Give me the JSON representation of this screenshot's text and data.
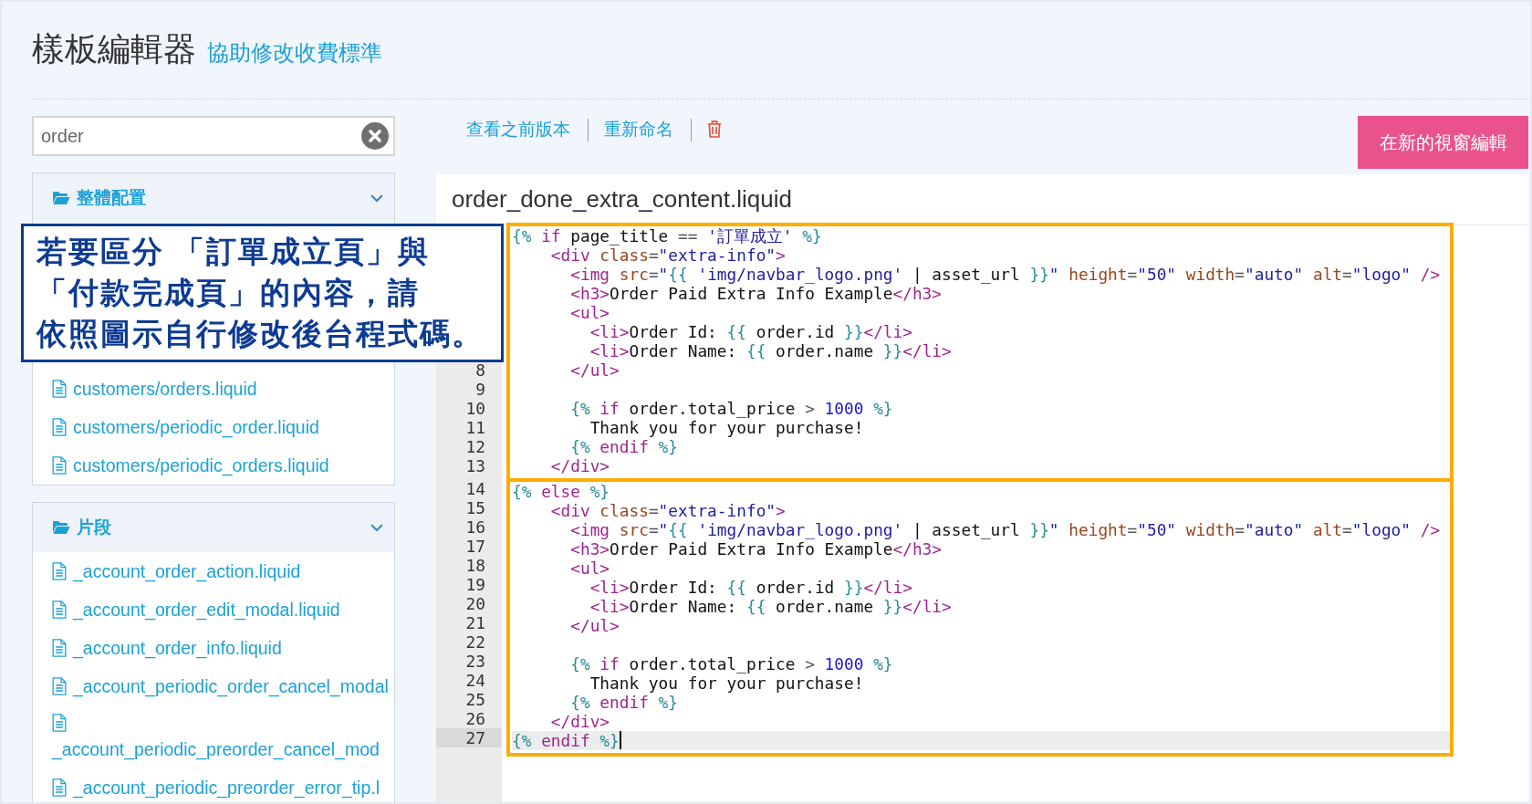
{
  "header": {
    "title": "樣板編輯器",
    "help_link": "協助修改收費標準"
  },
  "sidebar": {
    "search": {
      "value": "order"
    },
    "groups": [
      {
        "title": "整體配置",
        "expanded": true,
        "items": [
          {
            "name": "customers/orders.liquid",
            "kind": "inline"
          },
          {
            "name": "customers/periodic_order.liquid",
            "kind": "inline"
          },
          {
            "name": "customers/periodic_orders.liquid",
            "kind": "inline"
          }
        ]
      },
      {
        "title": "片段",
        "expanded": true,
        "items": [
          {
            "name": "_account_order_action.liquid",
            "kind": "inline"
          },
          {
            "name": "_account_order_edit_modal.liquid",
            "kind": "inline"
          },
          {
            "name": "_account_order_info.liquid",
            "kind": "inline"
          },
          {
            "name": "_account_periodic_order_cancel_modal",
            "kind": "inline"
          },
          {
            "name": "_account_periodic_preorder_cancel_mod",
            "kind": "stacked"
          },
          {
            "name": "_account_periodic_preorder_error_tip.l",
            "kind": "inline"
          }
        ]
      }
    ]
  },
  "toolbar": {
    "links": [
      "查看之前版本",
      "重新命名"
    ],
    "open_button": "在新的視窗編輯"
  },
  "editor": {
    "filename": "order_done_extra_content.liquid",
    "blocks": [
      {
        "lines": [
          {
            "current": false,
            "tokens": [
              {
                "kind": "delim",
                "text": "{%"
              },
              {
                "kind": "keyword",
                "text": " if"
              },
              {
                "kind": "text",
                "text": " page_title "
              },
              {
                "kind": "op",
                "text": "=="
              },
              {
                "kind": "string",
                "text": " '訂單成立'"
              },
              {
                "kind": "delim",
                "text": " %}"
              }
            ],
            "children": [
              {
                "current": false,
                "tokens": [
                  {
                    "kind": "tag",
                    "text": "<div"
                  },
                  {
                    "kind": "attr",
                    "text": " class"
                  },
                  {
                    "kind": "op",
                    "text": "="
                  },
                  {
                    "kind": "string",
                    "text": "\"extra-info\""
                  },
                  {
                    "kind": "tag",
                    "text": ">"
                  }
                ],
                "children": [
                  {
                    "current": false,
                    "tokens": [
                      {
                        "kind": "tag",
                        "text": "<img"
                      },
                      {
                        "kind": "attr",
                        "text": " src"
                      },
                      {
                        "kind": "op",
                        "text": "="
                      },
                      {
                        "kind": "string",
                        "text": "\""
                      },
                      {
                        "kind": "delim",
                        "text": "{{"
                      },
                      {
                        "kind": "string",
                        "text": " 'img/navbar_logo.png'"
                      },
                      {
                        "kind": "text",
                        "text": " | asset_url "
                      },
                      {
                        "kind": "delim",
                        "text": "}}"
                      },
                      {
                        "kind": "string",
                        "text": "\""
                      },
                      {
                        "kind": "attr",
                        "text": " height"
                      },
                      {
                        "kind": "op",
                        "text": "="
                      },
                      {
                        "kind": "string",
                        "text": "\"50\""
                      },
                      {
                        "kind": "attr",
                        "text": " width"
                      },
                      {
                        "kind": "op",
                        "text": "="
                      },
                      {
                        "kind": "string",
                        "text": "\"auto\""
                      },
                      {
                        "kind": "attr",
                        "text": " alt"
                      },
                      {
                        "kind": "op",
                        "text": "="
                      },
                      {
                        "kind": "string",
                        "text": "\"logo\""
                      },
                      {
                        "kind": "tag",
                        "text": " />"
                      }
                    ]
                  },
                  {
                    "current": false,
                    "tokens": [
                      {
                        "kind": "tag",
                        "text": "<h3>"
                      },
                      {
                        "kind": "text",
                        "text": "Order Paid Extra Info Example"
                      },
                      {
                        "kind": "tag",
                        "text": "</h3>"
                      }
                    ]
                  },
                  {
                    "current": false,
                    "tokens": [
                      {
                        "kind": "tag",
                        "text": "<ul>"
                      }
                    ],
                    "children": [
                      {
                        "current": false,
                        "tokens": [
                          {
                            "kind": "tag",
                            "text": "<li>"
                          },
                          {
                            "kind": "text",
                            "text": "Order Id: "
                          },
                          {
                            "kind": "delim",
                            "text": "{{"
                          },
                          {
                            "kind": "text",
                            "text": " order.id "
                          },
                          {
                            "kind": "delim",
                            "text": "}}"
                          },
                          {
                            "kind": "tag",
                            "text": "</li>"
                          }
                        ]
                      },
                      {
                        "current": false,
                        "tokens": [
                          {
                            "kind": "tag",
                            "text": "<li>"
                          },
                          {
                            "kind": "text",
                            "text": "Order Name: "
                          },
                          {
                            "kind": "delim",
                            "text": "{{"
                          },
                          {
                            "kind": "text",
                            "text": " order.name "
                          },
                          {
                            "kind": "delim",
                            "text": "}}"
                          },
                          {
                            "kind": "tag",
                            "text": "</li>"
                          }
                        ]
                      }
                    ]
                  },
                  {
                    "number": "8",
                    "current": false,
                    "tokens": [
                      {
                        "kind": "tag",
                        "text": "</ul>"
                      }
                    ]
                  },
                  {
                    "number": "9",
                    "current": false
                  },
                  {
                    "number": "10",
                    "current": false,
                    "tokens": [
                      {
                        "kind": "delim",
                        "text": "{%"
                      },
                      {
                        "kind": "keyword",
                        "text": " if"
                      },
                      {
                        "kind": "text",
                        "text": " order.total_price "
                      },
                      {
                        "kind": "op",
                        "text": ">"
                      },
                      {
                        "kind": "number",
                        "text": " 1000"
                      },
                      {
                        "kind": "delim",
                        "text": " %}"
                      }
                    ],
                    "children": [
                      {
                        "number": "11",
                        "current": false,
                        "tokens": [
                          {
                            "kind": "text",
                            "text": "Thank you for your purchase!"
                          }
                        ]
                      }
                    ]
                  },
                  {
                    "number": "12",
                    "current": false,
                    "tokens": [
                      {
                        "kind": "delim",
                        "text": "{%"
                      },
                      {
                        "kind": "keyword",
                        "text": " endif"
                      },
                      {
                        "kind": "delim",
                        "text": " %}"
                      }
                    ]
                  }
                ]
              },
              {
                "number": "13",
                "current": false,
                "tokens": [
                  {
                    "kind": "tag",
                    "text": "</div>"
                  }
                ]
              }
            ]
          }
        ]
      },
      {
        "lines": [
          {
            "number": "14",
            "current": false,
            "tokens": [
              {
                "kind": "delim",
                "text": "{%"
              },
              {
                "kind": "keyword",
                "text": " else"
              },
              {
                "kind": "delim",
                "text": " %}"
              }
            ],
            "children": [
              {
                "number": "15",
                "current": false,
                "tokens": [
                  {
                    "kind": "tag",
                    "text": "<div"
                  },
                  {
                    "kind": "attr",
                    "text": " class"
                  },
                  {
                    "kind": "op",
                    "text": "="
                  },
                  {
                    "kind": "string",
                    "text": "\"extra-info\""
                  },
                  {
                    "kind": "tag",
                    "text": ">"
                  }
                ],
                "children": [
                  {
                    "number": "16",
                    "current": false,
                    "tokens": [
                      {
                        "kind": "tag",
                        "text": "<img"
                      },
                      {
                        "kind": "attr",
                        "text": " src"
                      },
                      {
                        "kind": "op",
                        "text": "="
                      },
                      {
                        "kind": "string",
                        "text": "\""
                      },
                      {
                        "kind": "delim",
                        "text": "{{"
                      },
                      {
                        "kind": "string",
                        "text": " 'img/navbar_logo.png'"
                      },
                      {
                        "kind": "text",
                        "text": " | asset_url "
                      },
                      {
                        "kind": "delim",
                        "text": "}}"
                      },
                      {
                        "kind": "string",
                        "text": "\""
                      },
                      {
                        "kind": "attr",
                        "text": " height"
                      },
                      {
                        "kind": "op",
                        "text": "="
                      },
                      {
                        "kind": "string",
                        "text": "\"50\""
                      },
                      {
                        "kind": "attr",
                        "text": " width"
                      },
                      {
                        "kind": "op",
                        "text": "="
                      },
                      {
                        "kind": "string",
                        "text": "\"auto\""
                      },
                      {
                        "kind": "attr",
                        "text": " alt"
                      },
                      {
                        "kind": "op",
                        "text": "="
                      },
                      {
                        "kind": "string",
                        "text": "\"logo\""
                      },
                      {
                        "kind": "tag",
                        "text": " />"
                      }
                    ]
                  },
                  {
                    "number": "17",
                    "current": false,
                    "tokens": [
                      {
                        "kind": "tag",
                        "text": "<h3>"
                      },
                      {
                        "kind": "text",
                        "text": "Order Paid Extra Info Example"
                      },
                      {
                        "kind": "tag",
                        "text": "</h3>"
                      }
                    ]
                  },
                  {
                    "number": "18",
                    "current": false,
                    "tokens": [
                      {
                        "kind": "tag",
                        "text": "<ul>"
                      }
                    ],
                    "children": [
                      {
                        "number": "19",
                        "current": false,
                        "tokens": [
                          {
                            "kind": "tag",
                            "text": "<li>"
                          },
                          {
                            "kind": "text",
                            "text": "Order Id: "
                          },
                          {
                            "kind": "delim",
                            "text": "{{"
                          },
                          {
                            "kind": "text",
                            "text": " order.id "
                          },
                          {
                            "kind": "delim",
                            "text": "}}"
                          },
                          {
                            "kind": "tag",
                            "text": "</li>"
                          }
                        ]
                      },
                      {
                        "number": "20",
                        "current": false,
                        "tokens": [
                          {
                            "kind": "tag",
                            "text": "<li>"
                          },
                          {
                            "kind": "text",
                            "text": "Order Name: "
                          },
                          {
                            "kind": "delim",
                            "text": "{{"
                          },
                          {
                            "kind": "text",
                            "text": " order.name "
                          },
                          {
                            "kind": "delim",
                            "text": "}}"
                          },
                          {
                            "kind": "tag",
                            "text": "</li>"
                          }
                        ]
                      }
                    ]
                  },
                  {
                    "number": "21",
                    "current": false,
                    "tokens": [
                      {
                        "kind": "tag",
                        "text": "</ul>"
                      }
                    ]
                  },
                  {
                    "number": "22",
                    "current": false
                  },
                  {
                    "number": "23",
                    "current": false,
                    "tokens": [
                      {
                        "kind": "delim",
                        "text": "{%"
                      },
                      {
                        "kind": "keyword",
                        "text": " if"
                      },
                      {
                        "kind": "text",
                        "text": " order.total_price "
                      },
                      {
                        "kind": "op",
                        "text": ">"
                      },
                      {
                        "kind": "number",
                        "text": " 1000"
                      },
                      {
                        "kind": "delim",
                        "text": " %}"
                      }
                    ],
                    "children": [
                      {
                        "number": "24",
                        "current": false,
                        "tokens": [
                          {
                            "kind": "text",
                            "text": "Thank you for your purchase!"
                          }
                        ]
                      }
                    ]
                  },
                  {
                    "number": "25",
                    "current": false,
                    "tokens": [
                      {
                        "kind": "delim",
                        "text": "{%"
                      },
                      {
                        "kind": "keyword",
                        "text": " endif"
                      },
                      {
                        "kind": "delim",
                        "text": " %}"
                      }
                    ]
                  }
                ]
              },
              {
                "number": "26",
                "current": false,
                "tokens": [
                  {
                    "kind": "tag",
                    "text": "</div>"
                  }
                ]
              }
            ]
          },
          {
            "number": "27",
            "current": true,
            "tokens": [
              {
                "kind": "delim",
                "text": "{%"
              },
              {
                "kind": "keyword",
                "text": " endif"
              },
              {
                "kind": "delim",
                "text": " %}"
              }
            ]
          }
        ]
      }
    ]
  },
  "annotation": {
    "lines": [
      "若要區分 「訂單成立頁」與",
      "「付款完成頁」的內容，請",
      "依照圖示自行修改後台程式碼。"
    ]
  }
}
